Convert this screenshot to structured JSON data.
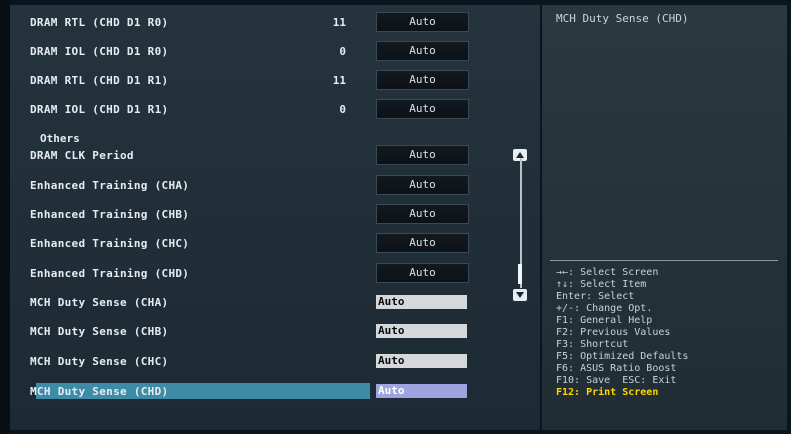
{
  "rows": [
    {
      "label": "DRAM RTL (CHD D1 R0)",
      "value": "11",
      "control": "Auto",
      "type": "button"
    },
    {
      "label": "DRAM IOL (CHD D1 R0)",
      "value": "0",
      "control": "Auto",
      "type": "button"
    },
    {
      "label": "DRAM RTL (CHD D1 R1)",
      "value": "11",
      "control": "Auto",
      "type": "button"
    },
    {
      "label": "DRAM IOL (CHD D1 R1)",
      "value": "0",
      "control": "Auto",
      "type": "button"
    }
  ],
  "section_title": "Others",
  "others": [
    {
      "label": "DRAM CLK Period",
      "control": "Auto",
      "type": "button"
    },
    {
      "label": "Enhanced Training (CHA)",
      "control": "Auto",
      "type": "button"
    },
    {
      "label": "Enhanced Training (CHB)",
      "control": "Auto",
      "type": "button"
    },
    {
      "label": "Enhanced Training (CHC)",
      "control": "Auto",
      "type": "button"
    },
    {
      "label": "Enhanced Training (CHD)",
      "control": "Auto",
      "type": "button"
    },
    {
      "label": "MCH Duty Sense (CHA)",
      "control": "Auto",
      "type": "field"
    },
    {
      "label": "MCH Duty Sense (CHB)",
      "control": "Auto",
      "type": "field"
    },
    {
      "label": "MCH Duty Sense (CHC)",
      "control": "Auto",
      "type": "field"
    },
    {
      "label": "MCH Duty Sense (CHD)",
      "control": "Auto",
      "type": "field",
      "selected": true
    }
  ],
  "side": {
    "title": "MCH Duty Sense (CHD)",
    "help": [
      "→←: Select Screen",
      "↑↓: Select Item",
      "Enter: Select",
      "+/-: Change Opt.",
      "F1: General Help",
      "F2: Previous Values",
      "F3: Shortcut",
      "F5: Optimized Defaults",
      "F6: ASUS Ratio Boost",
      "F10: Save  ESC: Exit",
      "F12: Print Screen"
    ]
  },
  "colors": {
    "highlight": "#3d8ba6",
    "selected_field": "#9fa3df",
    "hotkey": "#ffd400"
  },
  "icons": {
    "scroll_up": "triangle-up",
    "scroll_down": "triangle-down"
  }
}
